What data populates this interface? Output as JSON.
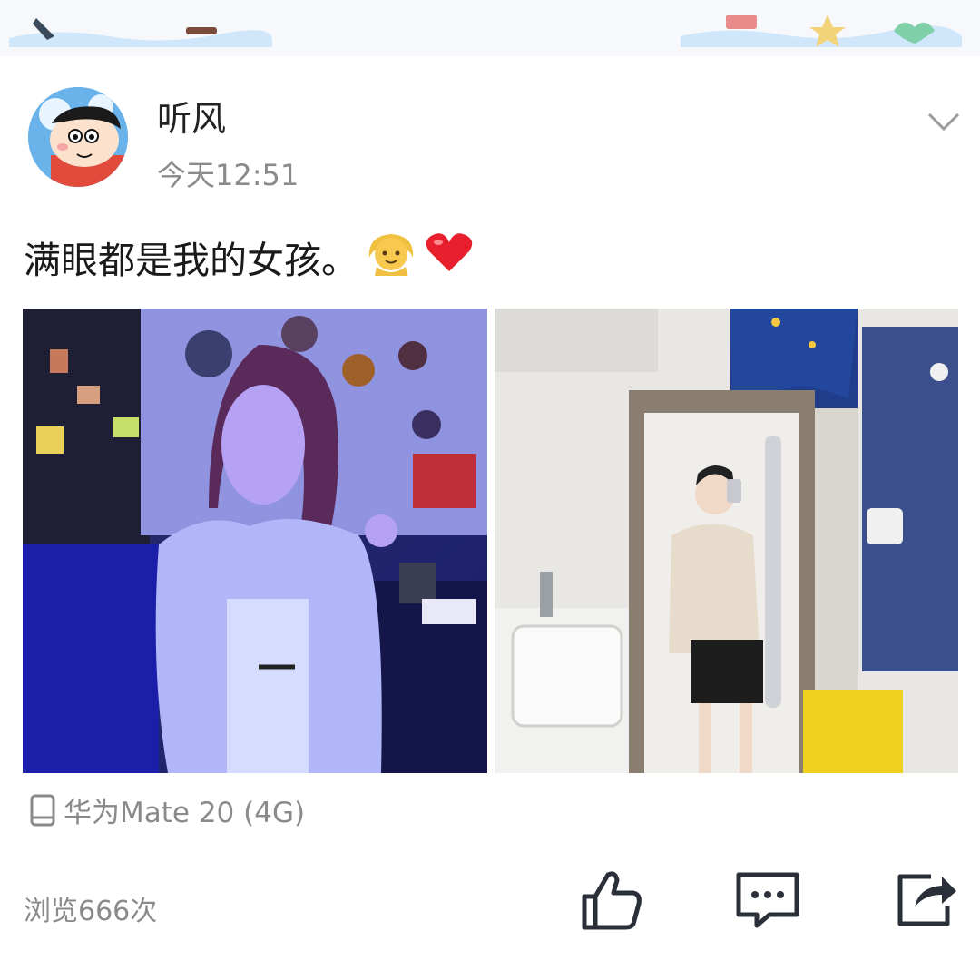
{
  "post": {
    "author": "听风",
    "time": "今天12:51",
    "text": "满眼都是我的女孩。",
    "emojis": [
      "girl-emoji",
      "red-heart-emoji"
    ],
    "photos": [
      {
        "name": "photo-girl-blue-light"
      },
      {
        "name": "photo-mirror-selfie"
      }
    ],
    "device": "华为Mate 20 (4G)",
    "views": "浏览666次"
  },
  "icons": {
    "more": "chevron-down-icon",
    "device": "phone-icon",
    "like": "thumbs-up-icon",
    "comment": "comment-icon",
    "share": "share-icon"
  },
  "colors": {
    "text": "#222222",
    "secondary": "#8a8a8a",
    "icon": "#2a2f3a"
  }
}
